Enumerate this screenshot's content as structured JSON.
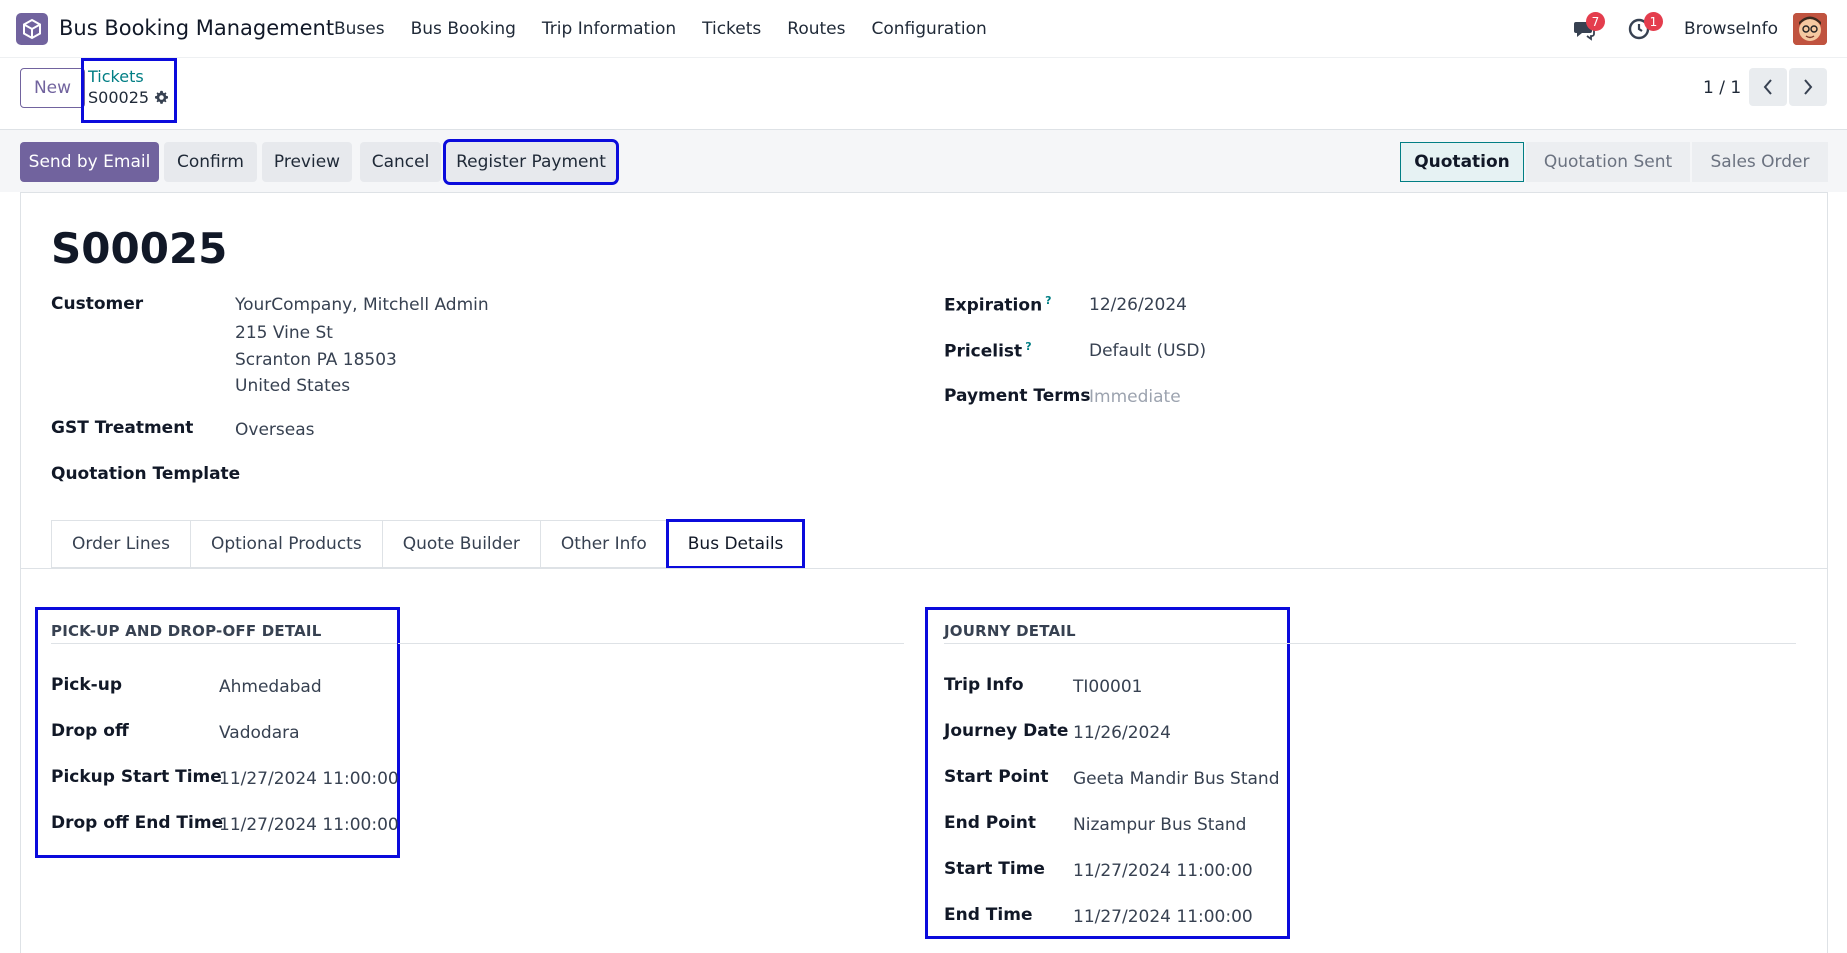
{
  "navbar": {
    "app_name": "Bus Booking Management",
    "menu": [
      "Buses",
      "Bus Booking",
      "Trip Information",
      "Tickets",
      "Routes",
      "Configuration"
    ],
    "messages_count": "7",
    "activities_count": "1",
    "company": "BrowseInfo"
  },
  "control": {
    "new_label": "New",
    "breadcrumb_parent": "Tickets",
    "breadcrumb_current": "S00025",
    "pager": "1 / 1"
  },
  "statusbar": {
    "buttons": [
      "Send by Email",
      "Confirm",
      "Preview",
      "Cancel",
      "Register Payment"
    ],
    "stages": [
      "Quotation",
      "Quotation Sent",
      "Sales Order"
    ],
    "active_stage": "Quotation"
  },
  "record": {
    "name": "S00025",
    "customer_label": "Customer",
    "customer_lines": [
      "YourCompany, Mitchell Admin",
      "215 Vine St",
      "Scranton PA 18503",
      "United States"
    ],
    "gst_label": "GST Treatment",
    "gst_value": "Overseas",
    "template_label": "Quotation Template",
    "expiration_label": "Expiration",
    "expiration_value": "12/26/2024",
    "pricelist_label": "Pricelist",
    "pricelist_value": "Default (USD)",
    "payment_terms_label": "Payment Terms",
    "payment_terms_value": "Immediate"
  },
  "tabs": [
    "Order Lines",
    "Optional Products",
    "Quote Builder",
    "Other Info",
    "Bus Details"
  ],
  "active_tab": "Bus Details",
  "pickup_group": {
    "title": "PICK-UP AND DROP-OFF DETAIL",
    "fields": [
      {
        "label": "Pick-up",
        "value": "Ahmedabad"
      },
      {
        "label": "Drop off",
        "value": "Vadodara"
      },
      {
        "label": "Pickup Start Time",
        "value": "11/27/2024 11:00:00"
      },
      {
        "label": "Drop off End Time",
        "value": "11/27/2024 11:00:00"
      }
    ]
  },
  "journey_group": {
    "title": "JOURNY DETAIL",
    "fields": [
      {
        "label": "Trip Info",
        "value": "TI00001"
      },
      {
        "label": "Journey Date",
        "value": "11/26/2024"
      },
      {
        "label": "Start Point",
        "value": "Geeta Mandir Bus Stand"
      },
      {
        "label": "End Point",
        "value": "Nizampur Bus Stand"
      },
      {
        "label": "Start Time",
        "value": "11/27/2024 11:00:00"
      },
      {
        "label": "End Time",
        "value": "11/27/2024 11:00:00"
      }
    ]
  }
}
